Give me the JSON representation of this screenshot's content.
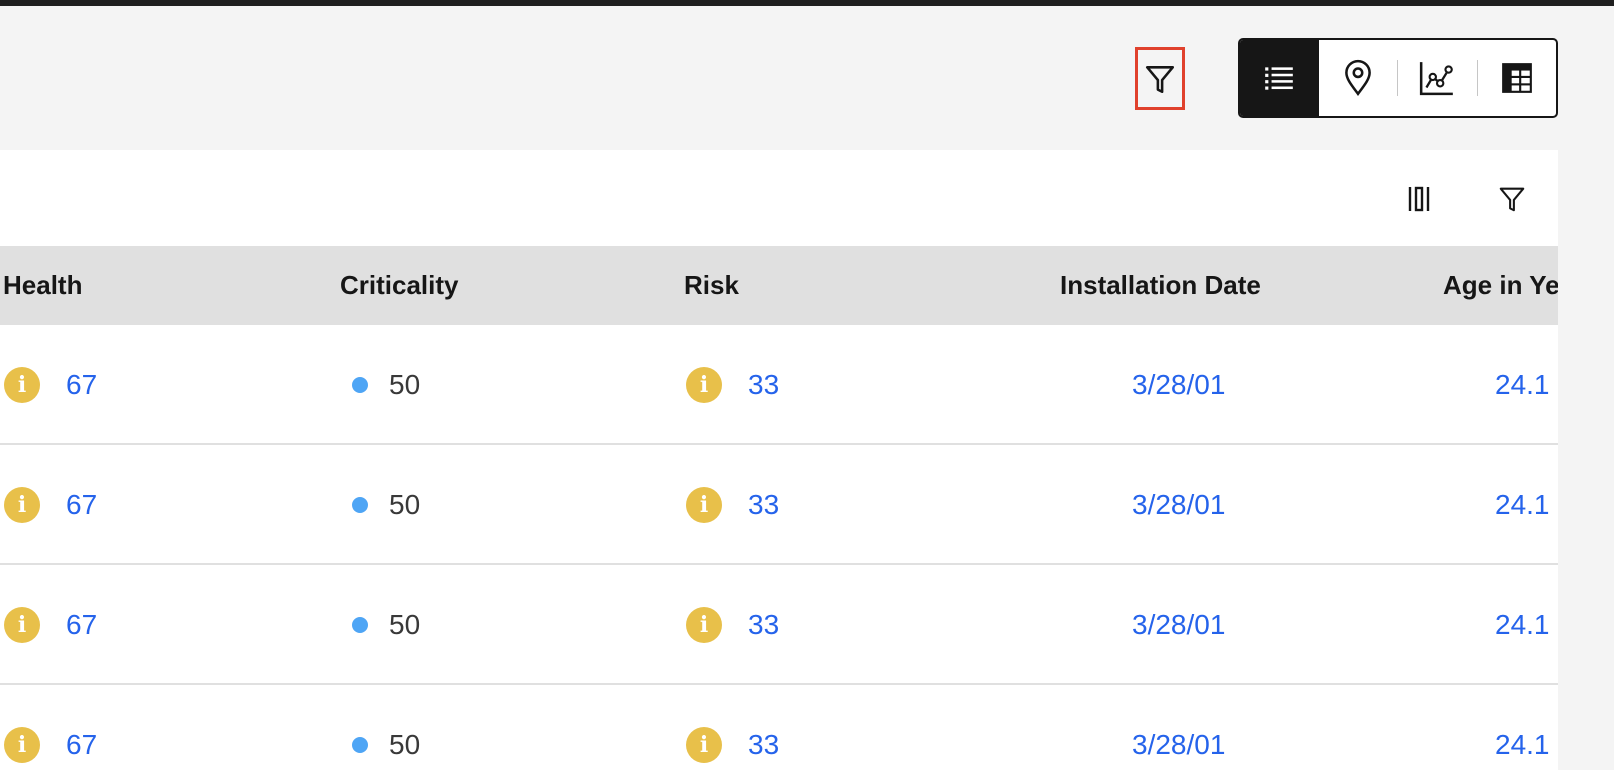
{
  "toolbar": {
    "filter_icon": "funnel-icon",
    "highlight_color": "#e0412c"
  },
  "view_switcher": {
    "active": "list",
    "views": [
      "list",
      "map",
      "chart",
      "table-grid"
    ]
  },
  "card_tools": {
    "columns_icon": "column-settings-icon",
    "filter_icon": "funnel-icon"
  },
  "table": {
    "columns": [
      "Health",
      "Criticality",
      "Risk",
      "Installation Date",
      "Age in Ye"
    ],
    "rows": [
      {
        "health": "67",
        "criticality": "50",
        "risk": "33",
        "installation_date": "3/28/01",
        "age": "24.1"
      },
      {
        "health": "67",
        "criticality": "50",
        "risk": "33",
        "installation_date": "3/28/01",
        "age": "24.1"
      },
      {
        "health": "67",
        "criticality": "50",
        "risk": "33",
        "installation_date": "3/28/01",
        "age": "24.1"
      },
      {
        "health": "67",
        "criticality": "50",
        "risk": "33",
        "installation_date": "3/28/01",
        "age": "24.1"
      }
    ],
    "info_icon_glyph": "i",
    "colors": {
      "info_icon": "#e8c04a",
      "criticality_dot": "#4ea5f5",
      "link": "#2563eb",
      "header_bg": "#e0e0e0"
    }
  }
}
